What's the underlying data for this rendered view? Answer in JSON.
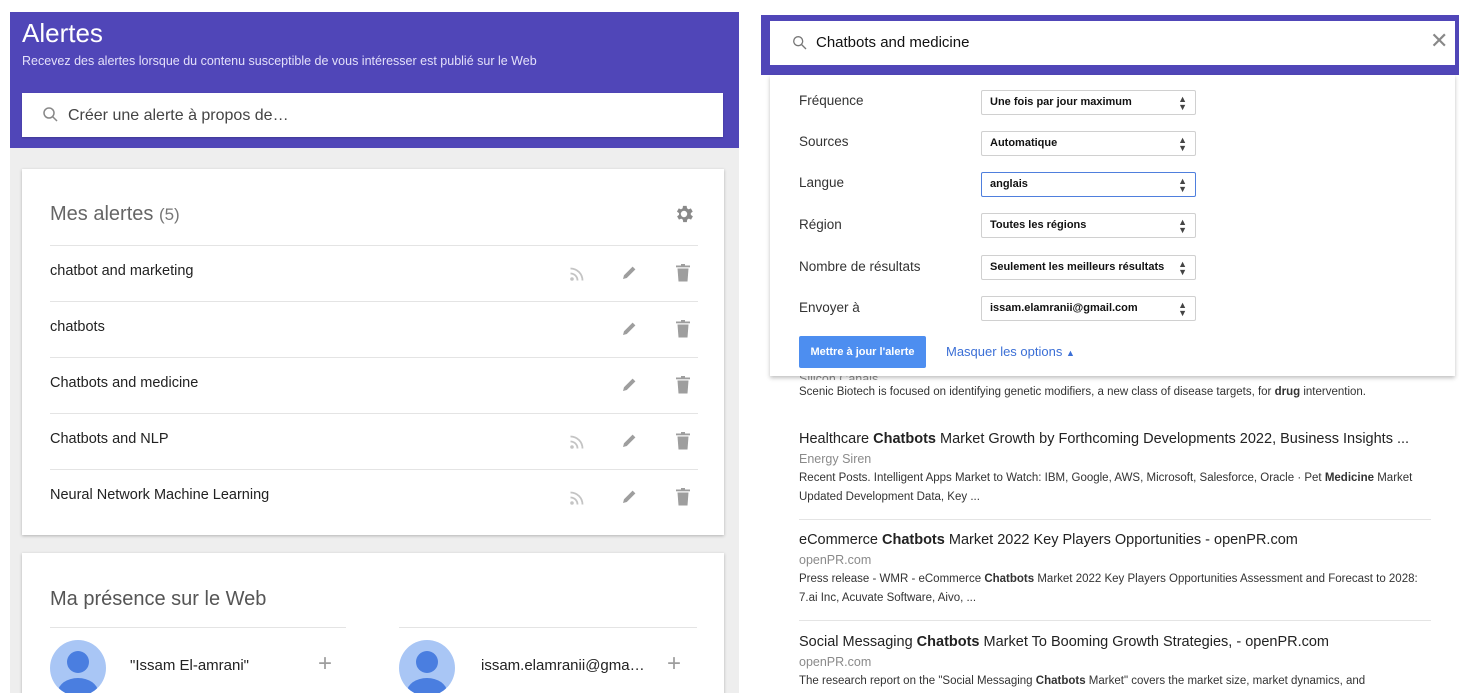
{
  "header": {
    "title": "Alertes",
    "subtitle": "Recevez des alertes lorsque du contenu susceptible de vous intéresser est publié sur le Web",
    "create_placeholder": "Créer une alerte à propos de…"
  },
  "my_alerts": {
    "title": "Mes alertes",
    "count": "(5)",
    "items": [
      {
        "label": "chatbot and marketing",
        "rss": true
      },
      {
        "label": "chatbots",
        "rss": false
      },
      {
        "label": "Chatbots and medicine",
        "rss": false
      },
      {
        "label": "Chatbots and NLP",
        "rss": true
      },
      {
        "label": "Neural Network Machine Learning",
        "rss": true
      }
    ]
  },
  "web_presence": {
    "title": "Ma présence sur le Web",
    "people": [
      {
        "name": "\"Issam El-amrani\""
      },
      {
        "name": "issam.elamranii@gma…"
      }
    ]
  },
  "search": {
    "query": "Chatbots and medicine"
  },
  "options": {
    "frequency": {
      "label": "Fréquence",
      "value": "Une fois par jour maximum"
    },
    "sources": {
      "label": "Sources",
      "value": "Automatique"
    },
    "language": {
      "label": "Langue",
      "value": "anglais"
    },
    "region": {
      "label": "Région",
      "value": "Toutes les régions"
    },
    "results_count": {
      "label": "Nombre de résultats",
      "value": "Seulement les meilleurs résultats"
    },
    "send_to": {
      "label": "Envoyer à",
      "value": "issam.elamranii@gmail.com"
    },
    "update_button": "Mettre à jour l'alerte",
    "hide_options": "Masquer les options"
  },
  "results": {
    "partial_source": "Silicon Canals",
    "partial_desc": [
      "Scenic Biotech is focused on identifying genetic modifiers, a new class of disease targets, for ",
      "drug",
      " intervention."
    ],
    "items": [
      {
        "title": [
          "Healthcare ",
          "Chatbots",
          " Market Growth by Forthcoming Developments 2022, Business Insights ..."
        ],
        "source": "Energy Siren",
        "desc": [
          "Recent Posts. Intelligent Apps Market to Watch: IBM, Google, AWS, Microsoft, Salesforce, Oracle · Pet ",
          "Medicine",
          " Market Updated Development Data, Key ..."
        ]
      },
      {
        "title": [
          "eCommerce ",
          "Chatbots",
          " Market 2022 Key Players Opportunities - openPR.com"
        ],
        "source": "openPR.com",
        "desc": [
          "Press release - WMR - eCommerce ",
          "Chatbots",
          " Market 2022 Key Players Opportunities Assessment and Forecast to 2028: 7.ai Inc, Acuvate Software, Aivo, ..."
        ]
      },
      {
        "title": [
          "Social Messaging ",
          "Chatbots",
          " Market To Booming Growth Strategies, - openPR.com"
        ],
        "source": "openPR.com",
        "desc": [
          "The research report on the \"Social Messaging ",
          "Chatbots",
          " Market\" covers the market size, market dynamics, and"
        ]
      }
    ]
  }
}
